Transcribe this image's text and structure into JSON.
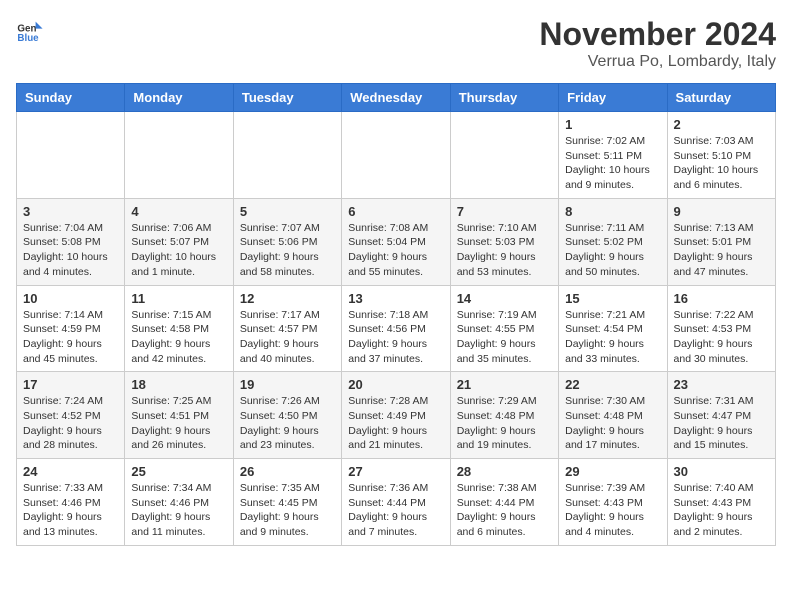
{
  "header": {
    "logo_general": "General",
    "logo_blue": "Blue",
    "month_year": "November 2024",
    "location": "Verrua Po, Lombardy, Italy"
  },
  "weekdays": [
    "Sunday",
    "Monday",
    "Tuesday",
    "Wednesday",
    "Thursday",
    "Friday",
    "Saturday"
  ],
  "weeks": [
    [
      {
        "day": "",
        "info": ""
      },
      {
        "day": "",
        "info": ""
      },
      {
        "day": "",
        "info": ""
      },
      {
        "day": "",
        "info": ""
      },
      {
        "day": "",
        "info": ""
      },
      {
        "day": "1",
        "info": "Sunrise: 7:02 AM\nSunset: 5:11 PM\nDaylight: 10 hours and 9 minutes."
      },
      {
        "day": "2",
        "info": "Sunrise: 7:03 AM\nSunset: 5:10 PM\nDaylight: 10 hours and 6 minutes."
      }
    ],
    [
      {
        "day": "3",
        "info": "Sunrise: 7:04 AM\nSunset: 5:08 PM\nDaylight: 10 hours and 4 minutes."
      },
      {
        "day": "4",
        "info": "Sunrise: 7:06 AM\nSunset: 5:07 PM\nDaylight: 10 hours and 1 minute."
      },
      {
        "day": "5",
        "info": "Sunrise: 7:07 AM\nSunset: 5:06 PM\nDaylight: 9 hours and 58 minutes."
      },
      {
        "day": "6",
        "info": "Sunrise: 7:08 AM\nSunset: 5:04 PM\nDaylight: 9 hours and 55 minutes."
      },
      {
        "day": "7",
        "info": "Sunrise: 7:10 AM\nSunset: 5:03 PM\nDaylight: 9 hours and 53 minutes."
      },
      {
        "day": "8",
        "info": "Sunrise: 7:11 AM\nSunset: 5:02 PM\nDaylight: 9 hours and 50 minutes."
      },
      {
        "day": "9",
        "info": "Sunrise: 7:13 AM\nSunset: 5:01 PM\nDaylight: 9 hours and 47 minutes."
      }
    ],
    [
      {
        "day": "10",
        "info": "Sunrise: 7:14 AM\nSunset: 4:59 PM\nDaylight: 9 hours and 45 minutes."
      },
      {
        "day": "11",
        "info": "Sunrise: 7:15 AM\nSunset: 4:58 PM\nDaylight: 9 hours and 42 minutes."
      },
      {
        "day": "12",
        "info": "Sunrise: 7:17 AM\nSunset: 4:57 PM\nDaylight: 9 hours and 40 minutes."
      },
      {
        "day": "13",
        "info": "Sunrise: 7:18 AM\nSunset: 4:56 PM\nDaylight: 9 hours and 37 minutes."
      },
      {
        "day": "14",
        "info": "Sunrise: 7:19 AM\nSunset: 4:55 PM\nDaylight: 9 hours and 35 minutes."
      },
      {
        "day": "15",
        "info": "Sunrise: 7:21 AM\nSunset: 4:54 PM\nDaylight: 9 hours and 33 minutes."
      },
      {
        "day": "16",
        "info": "Sunrise: 7:22 AM\nSunset: 4:53 PM\nDaylight: 9 hours and 30 minutes."
      }
    ],
    [
      {
        "day": "17",
        "info": "Sunrise: 7:24 AM\nSunset: 4:52 PM\nDaylight: 9 hours and 28 minutes."
      },
      {
        "day": "18",
        "info": "Sunrise: 7:25 AM\nSunset: 4:51 PM\nDaylight: 9 hours and 26 minutes."
      },
      {
        "day": "19",
        "info": "Sunrise: 7:26 AM\nSunset: 4:50 PM\nDaylight: 9 hours and 23 minutes."
      },
      {
        "day": "20",
        "info": "Sunrise: 7:28 AM\nSunset: 4:49 PM\nDaylight: 9 hours and 21 minutes."
      },
      {
        "day": "21",
        "info": "Sunrise: 7:29 AM\nSunset: 4:48 PM\nDaylight: 9 hours and 19 minutes."
      },
      {
        "day": "22",
        "info": "Sunrise: 7:30 AM\nSunset: 4:48 PM\nDaylight: 9 hours and 17 minutes."
      },
      {
        "day": "23",
        "info": "Sunrise: 7:31 AM\nSunset: 4:47 PM\nDaylight: 9 hours and 15 minutes."
      }
    ],
    [
      {
        "day": "24",
        "info": "Sunrise: 7:33 AM\nSunset: 4:46 PM\nDaylight: 9 hours and 13 minutes."
      },
      {
        "day": "25",
        "info": "Sunrise: 7:34 AM\nSunset: 4:46 PM\nDaylight: 9 hours and 11 minutes."
      },
      {
        "day": "26",
        "info": "Sunrise: 7:35 AM\nSunset: 4:45 PM\nDaylight: 9 hours and 9 minutes."
      },
      {
        "day": "27",
        "info": "Sunrise: 7:36 AM\nSunset: 4:44 PM\nDaylight: 9 hours and 7 minutes."
      },
      {
        "day": "28",
        "info": "Sunrise: 7:38 AM\nSunset: 4:44 PM\nDaylight: 9 hours and 6 minutes."
      },
      {
        "day": "29",
        "info": "Sunrise: 7:39 AM\nSunset: 4:43 PM\nDaylight: 9 hours and 4 minutes."
      },
      {
        "day": "30",
        "info": "Sunrise: 7:40 AM\nSunset: 4:43 PM\nDaylight: 9 hours and 2 minutes."
      }
    ]
  ]
}
